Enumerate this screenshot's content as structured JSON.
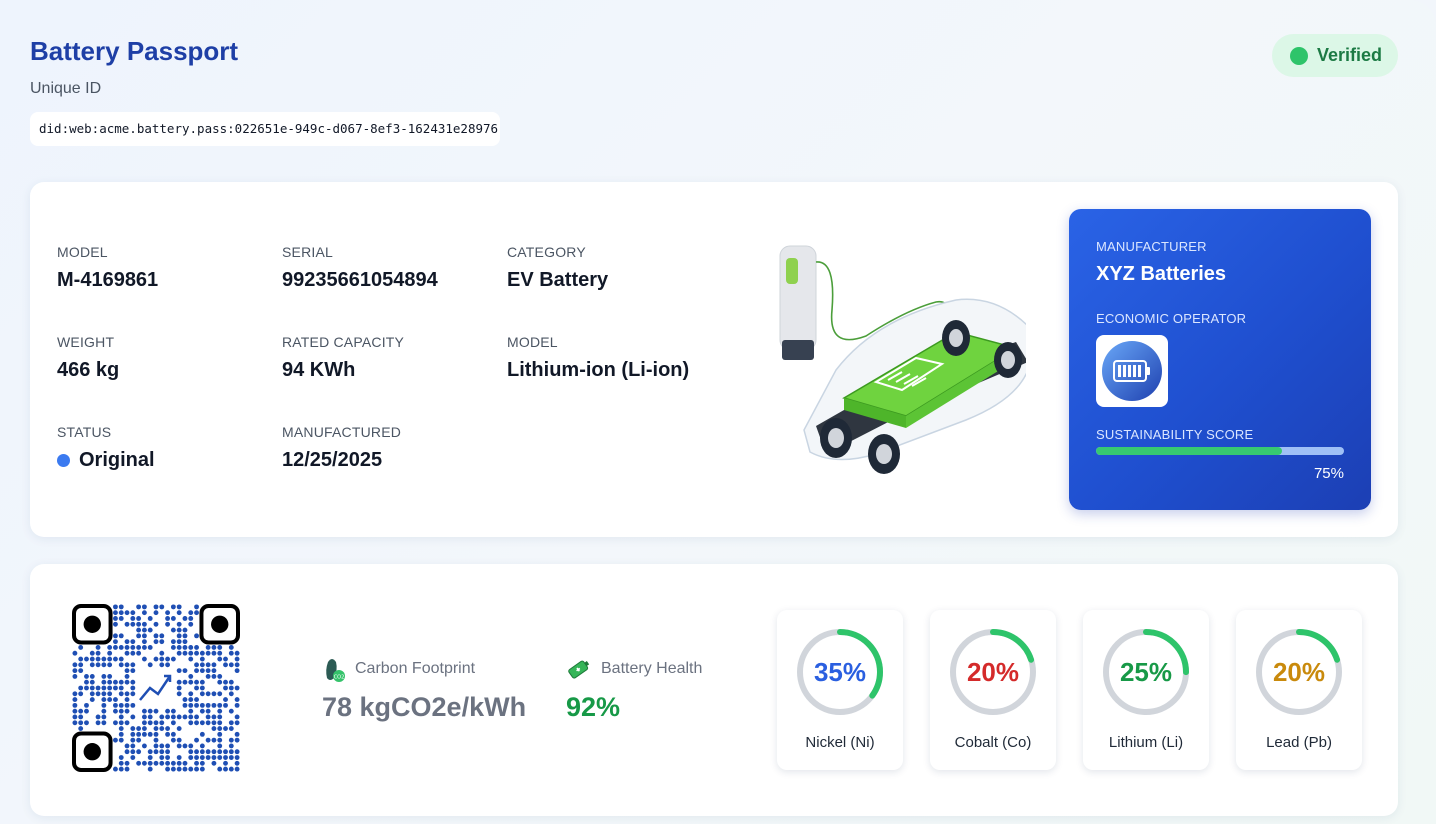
{
  "header": {
    "title": "Battery Passport",
    "uid_label": "Unique ID",
    "uid_value": "did:web:acme.battery.pass:022651e-949c-d067-8ef3-162431e28976",
    "verified_label": "Verified",
    "verified_color": "#2ec46a"
  },
  "specs": {
    "model_label": "MODEL",
    "model_value": "M-4169861",
    "serial_label": "SERIAL",
    "serial_value": "99235661054894",
    "category_label": "CATEGORY",
    "category_value": "EV Battery",
    "weight_label": "WEIGHT",
    "weight_value": "466 kg",
    "capacity_label": "RATED CAPACITY",
    "capacity_value": "94 KWh",
    "chemistry_label": "MODEL",
    "chemistry_value": "Lithium-ion (Li-ion)",
    "status_label": "STATUS",
    "status_value": "Original",
    "manufactured_label": "MANUFACTURED",
    "manufactured_value": "12/25/2025"
  },
  "manufacturer": {
    "label": "MANUFACTURER",
    "name": "XYZ Batteries",
    "operator_label": "ECONOMIC OPERATOR",
    "operator_logo_icon": "battery-logo-icon",
    "score_label": "SUSTAINABILITY SCORE",
    "score": 75,
    "score_text": "75%"
  },
  "metrics": {
    "carbon_icon": "footprint-icon",
    "carbon_label": "Carbon Footprint",
    "carbon_value": "78 kgCO2e/kWh",
    "health_icon": "battery-health-icon",
    "health_label": "Battery Health",
    "health_value": "92%"
  },
  "materials": [
    {
      "name": "Nickel (Ni)",
      "percent": 35,
      "text": "35%",
      "color": "#2a5fe0"
    },
    {
      "name": "Cobalt (Co)",
      "percent": 20,
      "text": "20%",
      "color": "#d42a2a"
    },
    {
      "name": "Lithium (Li)",
      "percent": 25,
      "text": "25%",
      "color": "#179947"
    },
    {
      "name": "Lead (Pb)",
      "percent": 20,
      "text": "20%",
      "color": "#c98a0c"
    }
  ],
  "colors": {
    "accent": "#1e3fa6",
    "gauge_track": "#d1d5db",
    "gauge_fill": "#2ec46a"
  }
}
